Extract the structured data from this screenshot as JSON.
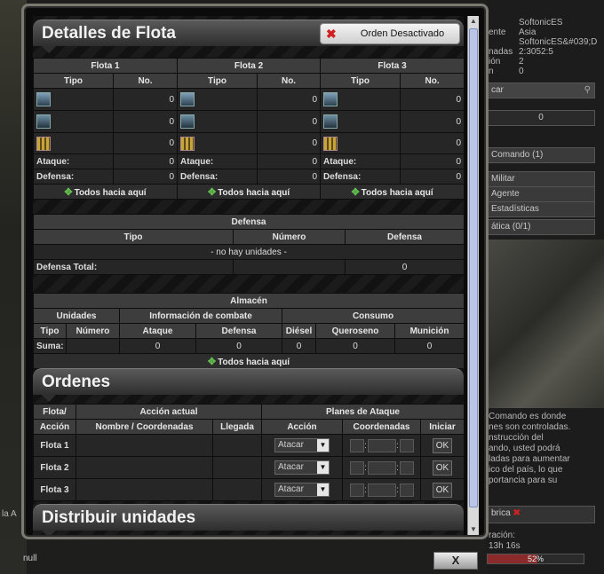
{
  "right_panel": {
    "lines": [
      "SoftonicES",
      "Asia",
      "SoftonicES&#039;D",
      "2:3052:5",
      "2",
      "0",
      "Comando (1)",
      "Militar",
      "Agente",
      "Estadísticas",
      "ática (0/1)"
    ],
    "side_labels": [
      "ente",
      "nadas",
      "ión",
      "n"
    ],
    "search_placeholder": "car",
    "counter": "0",
    "description": [
      "Comando es donde",
      "nes son controladas.",
      "nstrucción del",
      "ando, usted podrá",
      "ladas para aumentar",
      "ico del país, lo que",
      "portancia para su"
    ],
    "build_label": "brica",
    "duration_label": "ración:",
    "duration_value": "13h 16s",
    "progress_text": "52%",
    "progress_value": 0.52
  },
  "left_strip": {
    "text": "la A"
  },
  "status": "null",
  "close_label": "X",
  "fleet": {
    "title": "Detalles de Flota",
    "toggle_label": "Orden Desactivado",
    "col_tipo": "Tipo",
    "col_no": "No.",
    "fleets": [
      {
        "name": "Flota 1",
        "counts": [
          "0",
          "0",
          "0"
        ],
        "ataque": "0",
        "defensa": "0"
      },
      {
        "name": "Flota 2",
        "counts": [
          "0",
          "0",
          "0"
        ],
        "ataque": "0",
        "defensa": "0"
      },
      {
        "name": "Flota 3",
        "counts": [
          "0",
          "0",
          "0"
        ],
        "ataque": "0",
        "defensa": "0"
      }
    ],
    "ataque_label": "Ataque:",
    "defensa_label": "Defensa:",
    "all_here": "Todos hacia aquí"
  },
  "defense": {
    "title": "Defensa",
    "cols": [
      "Tipo",
      "Número",
      "Defensa"
    ],
    "empty": "- no hay unidades -",
    "total_label": "Defensa Total:",
    "total_value": "0"
  },
  "storage": {
    "title": "Almacén",
    "groups": [
      "Unidades",
      "Información de combate",
      "Consumo"
    ],
    "cols": [
      "Tipo",
      "Número",
      "Ataque",
      "Defensa",
      "Diésel",
      "Queroseno",
      "Munición"
    ],
    "sum_label": "Suma:",
    "sum_values": [
      "0",
      "0",
      "0",
      "0",
      "0"
    ],
    "all_here": "Todos hacia aquí"
  },
  "orders": {
    "title": "Ordenes",
    "col_flota": "Flota/",
    "col_accion": "Acción",
    "current_action": "Acción actual",
    "attack_plans": "Planes de Ataque",
    "col_name": "Nombre / Coordenadas",
    "col_arrival": "Llegada",
    "col_action": "Acción",
    "col_coords": "Coordenadas",
    "col_start": "Iniciar",
    "rows": [
      {
        "fleet": "Flota 1",
        "action": "Atacar",
        "ok": "OK"
      },
      {
        "fleet": "Flota 2",
        "action": "Atacar",
        "ok": "OK"
      },
      {
        "fleet": "Flota 3",
        "action": "Atacar",
        "ok": "OK"
      }
    ]
  },
  "distribute": {
    "title": "Distribuir unidades"
  }
}
